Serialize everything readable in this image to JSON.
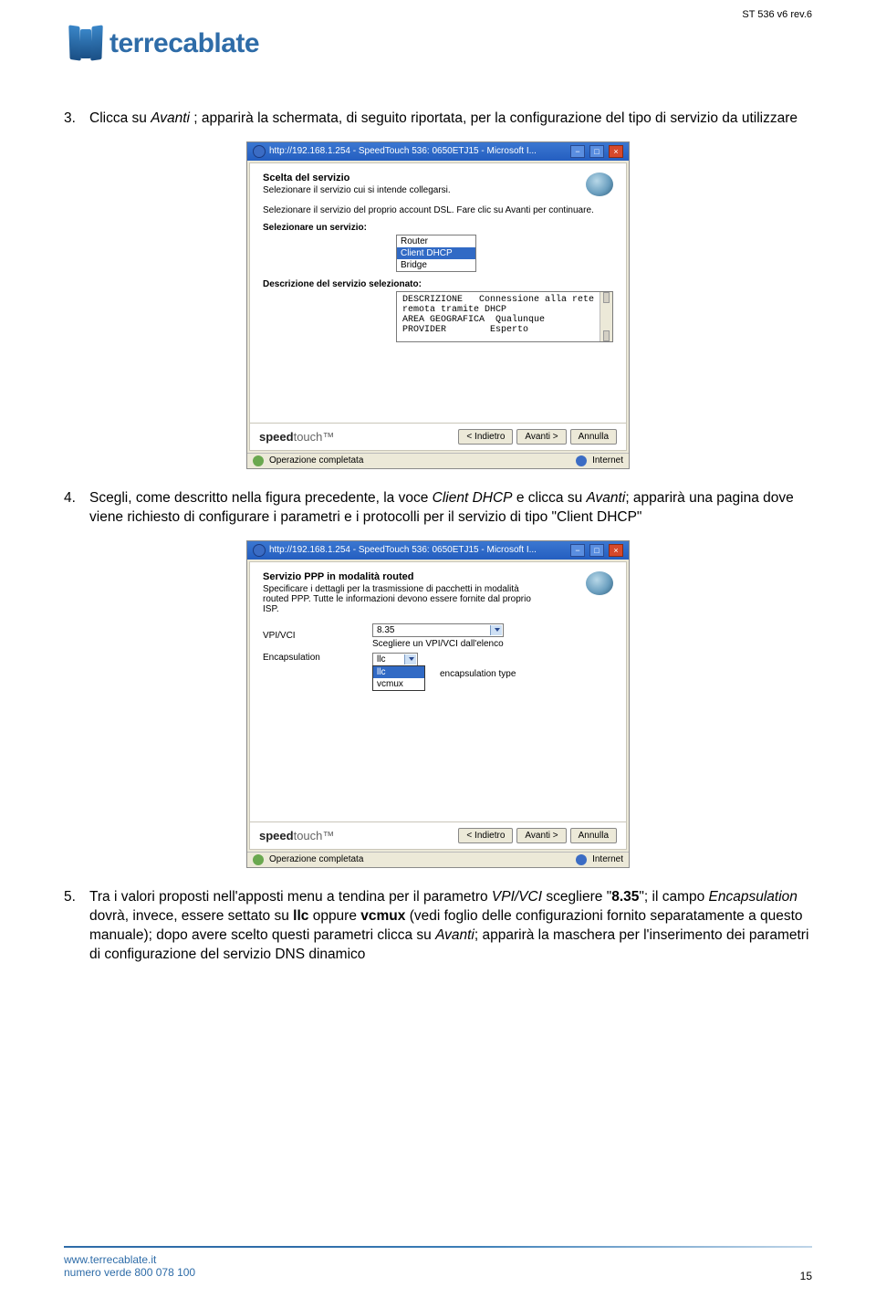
{
  "doc_header": "ST 536 v6 rev.6",
  "logo_text": "terrecablate",
  "steps": {
    "s3": {
      "num": "3.",
      "text_a": "Clicca su ",
      "text_b": "Avanti",
      "text_c": " ; apparirà la schermata, di seguito riportata, per la configurazione del tipo di servizio da utilizzare"
    },
    "s4": {
      "num": "4.",
      "text_a": "Scegli, come descritto nella figura precedente, la voce ",
      "text_b": "Client DHCP",
      "text_c": " e clicca su ",
      "text_d": "Avanti",
      "text_e": "; apparirà una pagina dove viene richiesto di configurare i parametri e i protocolli per il servizio di tipo \"Client DHCP\""
    },
    "s5": {
      "num": "5.",
      "text_a": "Tra i valori proposti nell'apposti menu a tendina per  il parametro ",
      "text_b": "VPI/VCI",
      "text_c": " scegliere \"",
      "text_d": "8.35",
      "text_e": "\"; il campo ",
      "text_f": "Encapsulation",
      "text_g": " dovrà, invece, essere settato su ",
      "text_h": "llc",
      "text_i": " oppure ",
      "text_j": "vcmux",
      "text_k": " (vedi foglio delle configurazioni fornito separatamente a questo manuale); dopo avere scelto questi parametri clicca su ",
      "text_l": "Avanti",
      "text_m": "; apparirà la maschera per l'inserimento dei parametri di configurazione del servizio DNS dinamico"
    }
  },
  "ss1": {
    "title": "http://192.168.1.254 - SpeedTouch 536:  0650ETJ15 - Microsoft I...",
    "heading": "Scelta del servizio",
    "sub": "Selezionare il servizio cui si intende collegarsi.",
    "instr": "Selezionare il servizio del proprio account DSL. Fare clic su Avanti per continuare.",
    "label_select": "Selezionare un servizio:",
    "options": {
      "a": "Router",
      "b": "Client DHCP",
      "c": "Bridge"
    },
    "label_desc": "Descrizione del servizio selezionato:",
    "desc_line1a": "DESCRIZIONE",
    "desc_line1b": "Connessione alla rete",
    "desc_line2": "remota tramite DHCP",
    "desc_line3a": "AREA GEOGRAFICA",
    "desc_line3b": "Qualunque",
    "desc_line4a": "PROVIDER",
    "desc_line4b": "Esperto",
    "brand_a": "speed",
    "brand_b": "touch",
    "btn_back": "< Indietro",
    "btn_next": "Avanti >",
    "btn_cancel": "Annulla",
    "status_left": "Operazione completata",
    "status_right": "Internet"
  },
  "ss2": {
    "title": "http://192.168.1.254 - SpeedTouch 536:  0650ETJ15 - Microsoft I...",
    "heading": "Servizio PPP in modalità routed",
    "sub": "Specificare i dettagli per la trasmissione di pacchetti in modalità routed PPP. Tutte le informazioni devono essere fornite dal proprio ISP.",
    "field1_label": "VPI/VCI",
    "field1_value": "8.35",
    "field1_hint": "Scegliere un VPI/VCI dall'elenco",
    "field2_label": "Encapsulation",
    "field2_value": "llc",
    "field2_opt1": "llc",
    "field2_opt2": "vcmux",
    "field2_hint": "encapsulation type",
    "brand_a": "speed",
    "brand_b": "touch",
    "btn_back": "< Indietro",
    "btn_next": "Avanti >",
    "btn_cancel": "Annulla",
    "status_left": "Operazione completata",
    "status_right": "Internet"
  },
  "footer": {
    "url": "www.terrecablate.it",
    "phone": "numero verde 800 078 100",
    "page": "15"
  }
}
